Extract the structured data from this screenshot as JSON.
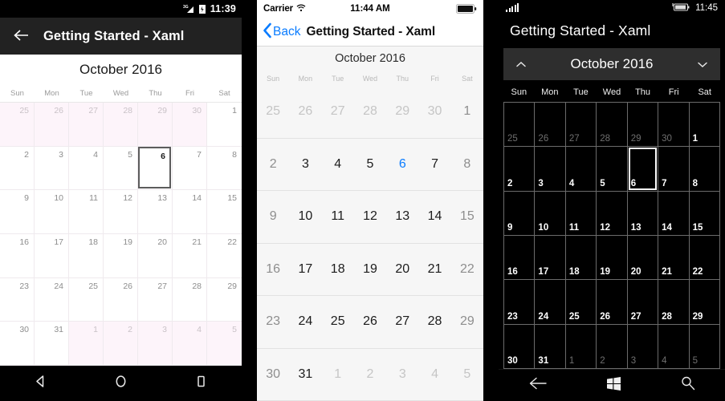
{
  "android": {
    "status": {
      "time": "11:39",
      "signal_icon": "3g-signal-icon",
      "battery_icon": "battery-charging-icon"
    },
    "appbar": {
      "back_icon": "arrow-left-icon",
      "title": "Getting Started - Xaml"
    },
    "calendar": {
      "month_label": "October 2016",
      "day_names": [
        "Sun",
        "Mon",
        "Tue",
        "Wed",
        "Thu",
        "Fri",
        "Sat"
      ],
      "selected_day": 6,
      "weeks": [
        [
          {
            "d": "25",
            "out": true
          },
          {
            "d": "26",
            "out": true
          },
          {
            "d": "27",
            "out": true
          },
          {
            "d": "28",
            "out": true
          },
          {
            "d": "29",
            "out": true
          },
          {
            "d": "30",
            "out": true
          },
          {
            "d": "1",
            "out": false
          }
        ],
        [
          {
            "d": "2",
            "out": false
          },
          {
            "d": "3",
            "out": false
          },
          {
            "d": "4",
            "out": false
          },
          {
            "d": "5",
            "out": false
          },
          {
            "d": "6",
            "out": false,
            "sel": true
          },
          {
            "d": "7",
            "out": false
          },
          {
            "d": "8",
            "out": false
          }
        ],
        [
          {
            "d": "9",
            "out": false
          },
          {
            "d": "10",
            "out": false
          },
          {
            "d": "11",
            "out": false
          },
          {
            "d": "12",
            "out": false
          },
          {
            "d": "13",
            "out": false
          },
          {
            "d": "14",
            "out": false
          },
          {
            "d": "15",
            "out": false
          }
        ],
        [
          {
            "d": "16",
            "out": false
          },
          {
            "d": "17",
            "out": false
          },
          {
            "d": "18",
            "out": false
          },
          {
            "d": "19",
            "out": false
          },
          {
            "d": "20",
            "out": false
          },
          {
            "d": "21",
            "out": false
          },
          {
            "d": "22",
            "out": false
          }
        ],
        [
          {
            "d": "23",
            "out": false
          },
          {
            "d": "24",
            "out": false
          },
          {
            "d": "25",
            "out": false
          },
          {
            "d": "26",
            "out": false
          },
          {
            "d": "27",
            "out": false
          },
          {
            "d": "28",
            "out": false
          },
          {
            "d": "29",
            "out": false
          }
        ],
        [
          {
            "d": "30",
            "out": false
          },
          {
            "d": "31",
            "out": false
          },
          {
            "d": "1",
            "out": true
          },
          {
            "d": "2",
            "out": true
          },
          {
            "d": "3",
            "out": true
          },
          {
            "d": "4",
            "out": true
          },
          {
            "d": "5",
            "out": true
          }
        ]
      ]
    },
    "navbar": {
      "back_icon": "triangle-back-icon",
      "home_icon": "circle-home-icon",
      "recents_icon": "square-recents-icon"
    },
    "colors": {
      "appbar_bg": "#222222",
      "out_of_month_bg": "#fdf4fa",
      "selection_border": "#5c5c5c"
    }
  },
  "ios": {
    "status": {
      "carrier": "Carrier",
      "wifi_icon": "wifi-icon",
      "time": "11:44 AM",
      "battery_icon": "battery-full-icon"
    },
    "navbar": {
      "back_icon": "chevron-left-icon",
      "back_label": "Back",
      "title": "Getting Started - Xaml"
    },
    "calendar": {
      "month_label": "October 2016",
      "day_names": [
        "Sun",
        "Mon",
        "Tue",
        "Wed",
        "Thu",
        "Fri",
        "Sat"
      ],
      "selected_day": 6,
      "weeks": [
        [
          {
            "d": "25",
            "out": true
          },
          {
            "d": "26",
            "out": true
          },
          {
            "d": "27",
            "out": true
          },
          {
            "d": "28",
            "out": true
          },
          {
            "d": "29",
            "out": true
          },
          {
            "d": "30",
            "out": true
          },
          {
            "d": "1",
            "out": false,
            "wk": true
          }
        ],
        [
          {
            "d": "2",
            "out": false,
            "wk": true
          },
          {
            "d": "3",
            "out": false
          },
          {
            "d": "4",
            "out": false
          },
          {
            "d": "5",
            "out": false
          },
          {
            "d": "6",
            "out": false,
            "sel": true
          },
          {
            "d": "7",
            "out": false
          },
          {
            "d": "8",
            "out": false,
            "wk": true
          }
        ],
        [
          {
            "d": "9",
            "out": false,
            "wk": true
          },
          {
            "d": "10",
            "out": false
          },
          {
            "d": "11",
            "out": false
          },
          {
            "d": "12",
            "out": false
          },
          {
            "d": "13",
            "out": false
          },
          {
            "d": "14",
            "out": false
          },
          {
            "d": "15",
            "out": false,
            "wk": true
          }
        ],
        [
          {
            "d": "16",
            "out": false,
            "wk": true
          },
          {
            "d": "17",
            "out": false
          },
          {
            "d": "18",
            "out": false
          },
          {
            "d": "19",
            "out": false
          },
          {
            "d": "20",
            "out": false
          },
          {
            "d": "21",
            "out": false
          },
          {
            "d": "22",
            "out": false,
            "wk": true
          }
        ],
        [
          {
            "d": "23",
            "out": false,
            "wk": true
          },
          {
            "d": "24",
            "out": false
          },
          {
            "d": "25",
            "out": false
          },
          {
            "d": "26",
            "out": false
          },
          {
            "d": "27",
            "out": false
          },
          {
            "d": "28",
            "out": false
          },
          {
            "d": "29",
            "out": false,
            "wk": true
          }
        ],
        [
          {
            "d": "30",
            "out": false,
            "wk": true
          },
          {
            "d": "31",
            "out": false
          },
          {
            "d": "1",
            "out": true
          },
          {
            "d": "2",
            "out": true
          },
          {
            "d": "3",
            "out": true
          },
          {
            "d": "4",
            "out": true
          },
          {
            "d": "5",
            "out": true
          }
        ]
      ]
    },
    "colors": {
      "accent": "#0a7cff",
      "bg": "#f6f6f6"
    }
  },
  "wp": {
    "status": {
      "signal_icon": "signal-bars-icon",
      "battery_icon": "battery-icon",
      "time": "11:45"
    },
    "appbar": {
      "title": "Getting Started - Xaml"
    },
    "calendar": {
      "month_label": "October 2016",
      "prev_icon": "chevron-up-icon",
      "next_icon": "chevron-down-icon",
      "day_names": [
        "Sun",
        "Mon",
        "Tue",
        "Wed",
        "Thu",
        "Fri",
        "Sat"
      ],
      "selected_day": 6,
      "weeks": [
        [
          {
            "d": "25",
            "out": true
          },
          {
            "d": "26",
            "out": true
          },
          {
            "d": "27",
            "out": true
          },
          {
            "d": "28",
            "out": true
          },
          {
            "d": "29",
            "out": true
          },
          {
            "d": "30",
            "out": true
          },
          {
            "d": "1",
            "out": false
          }
        ],
        [
          {
            "d": "2",
            "out": false
          },
          {
            "d": "3",
            "out": false
          },
          {
            "d": "4",
            "out": false
          },
          {
            "d": "5",
            "out": false
          },
          {
            "d": "6",
            "out": false,
            "sel": true
          },
          {
            "d": "7",
            "out": false
          },
          {
            "d": "8",
            "out": false
          }
        ],
        [
          {
            "d": "9",
            "out": false
          },
          {
            "d": "10",
            "out": false
          },
          {
            "d": "11",
            "out": false
          },
          {
            "d": "12",
            "out": false
          },
          {
            "d": "13",
            "out": false
          },
          {
            "d": "14",
            "out": false
          },
          {
            "d": "15",
            "out": false
          }
        ],
        [
          {
            "d": "16",
            "out": false
          },
          {
            "d": "17",
            "out": false
          },
          {
            "d": "18",
            "out": false
          },
          {
            "d": "19",
            "out": false
          },
          {
            "d": "20",
            "out": false
          },
          {
            "d": "21",
            "out": false
          },
          {
            "d": "22",
            "out": false
          }
        ],
        [
          {
            "d": "23",
            "out": false
          },
          {
            "d": "24",
            "out": false
          },
          {
            "d": "25",
            "out": false
          },
          {
            "d": "26",
            "out": false
          },
          {
            "d": "27",
            "out": false
          },
          {
            "d": "28",
            "out": false
          },
          {
            "d": "29",
            "out": false
          }
        ],
        [
          {
            "d": "30",
            "out": false
          },
          {
            "d": "31",
            "out": false
          },
          {
            "d": "1",
            "out": true
          },
          {
            "d": "2",
            "out": true
          },
          {
            "d": "3",
            "out": true
          },
          {
            "d": "4",
            "out": true
          },
          {
            "d": "5",
            "out": true
          }
        ]
      ]
    },
    "navbar": {
      "back_icon": "arrow-left-icon",
      "start_icon": "windows-logo-icon",
      "search_icon": "search-icon"
    },
    "colors": {
      "month_header_bg": "#2e2e2e",
      "grid_line": "#6b6b6b",
      "selection_border": "#ffffff"
    }
  }
}
